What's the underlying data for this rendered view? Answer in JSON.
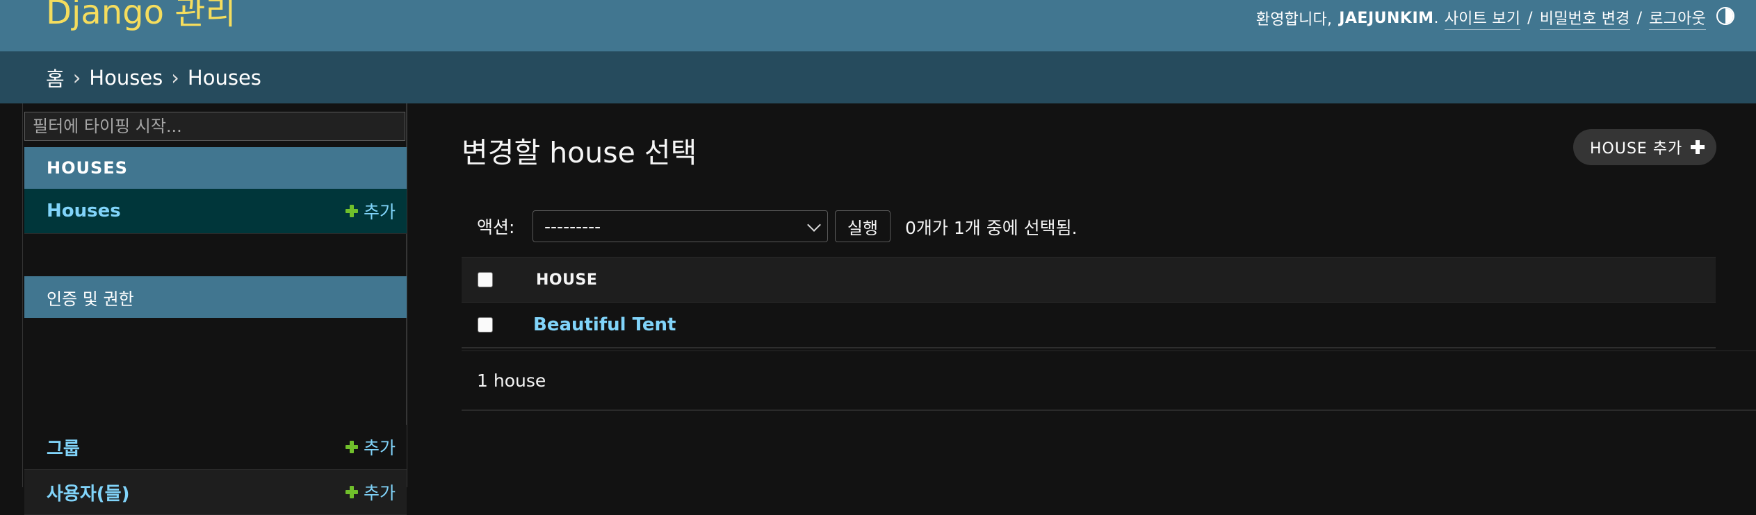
{
  "header": {
    "branding": "Django 관리",
    "welcome": "환영합니다,",
    "username": "JAEJUNKIM",
    "period": ".",
    "view_site": "사이트 보기",
    "change_password": "비밀번호 변경",
    "logout": "로그아웃",
    "separator": "/"
  },
  "breadcrumbs": {
    "home": "홈",
    "separator": "›",
    "app": "Houses",
    "model": "Houses"
  },
  "sidebar": {
    "filter_placeholder": "필터에 타이핑 시작...",
    "apps": [
      {
        "caption": "HOUSES",
        "models": [
          {
            "name": "Houses",
            "add_label": "추가"
          }
        ]
      },
      {
        "caption": "인증 및 권한",
        "models": [
          {
            "name": "그룹",
            "add_label": "추가"
          },
          {
            "name": "사용자(들)",
            "add_label": "추가"
          }
        ]
      }
    ]
  },
  "content": {
    "title": "변경할 house 선택",
    "add_button": "HOUSE 추가",
    "actions": {
      "label": "액션:",
      "selected_option": "---------",
      "go_button": "실행",
      "counter": "0개가 1개 중에 선택됨."
    },
    "table": {
      "columns": [
        "HOUSE"
      ],
      "rows": [
        "Beautiful Tent"
      ]
    },
    "paginator": "1 house"
  },
  "colors": {
    "header_bg": "#417690",
    "branding": "#f5dd5d",
    "breadcrumbs_bg": "#264b5d",
    "link": "#81d4fa",
    "add_plus": "#70bf2b",
    "selected_model_bg": "#00363a",
    "page_bg": "#121212"
  }
}
